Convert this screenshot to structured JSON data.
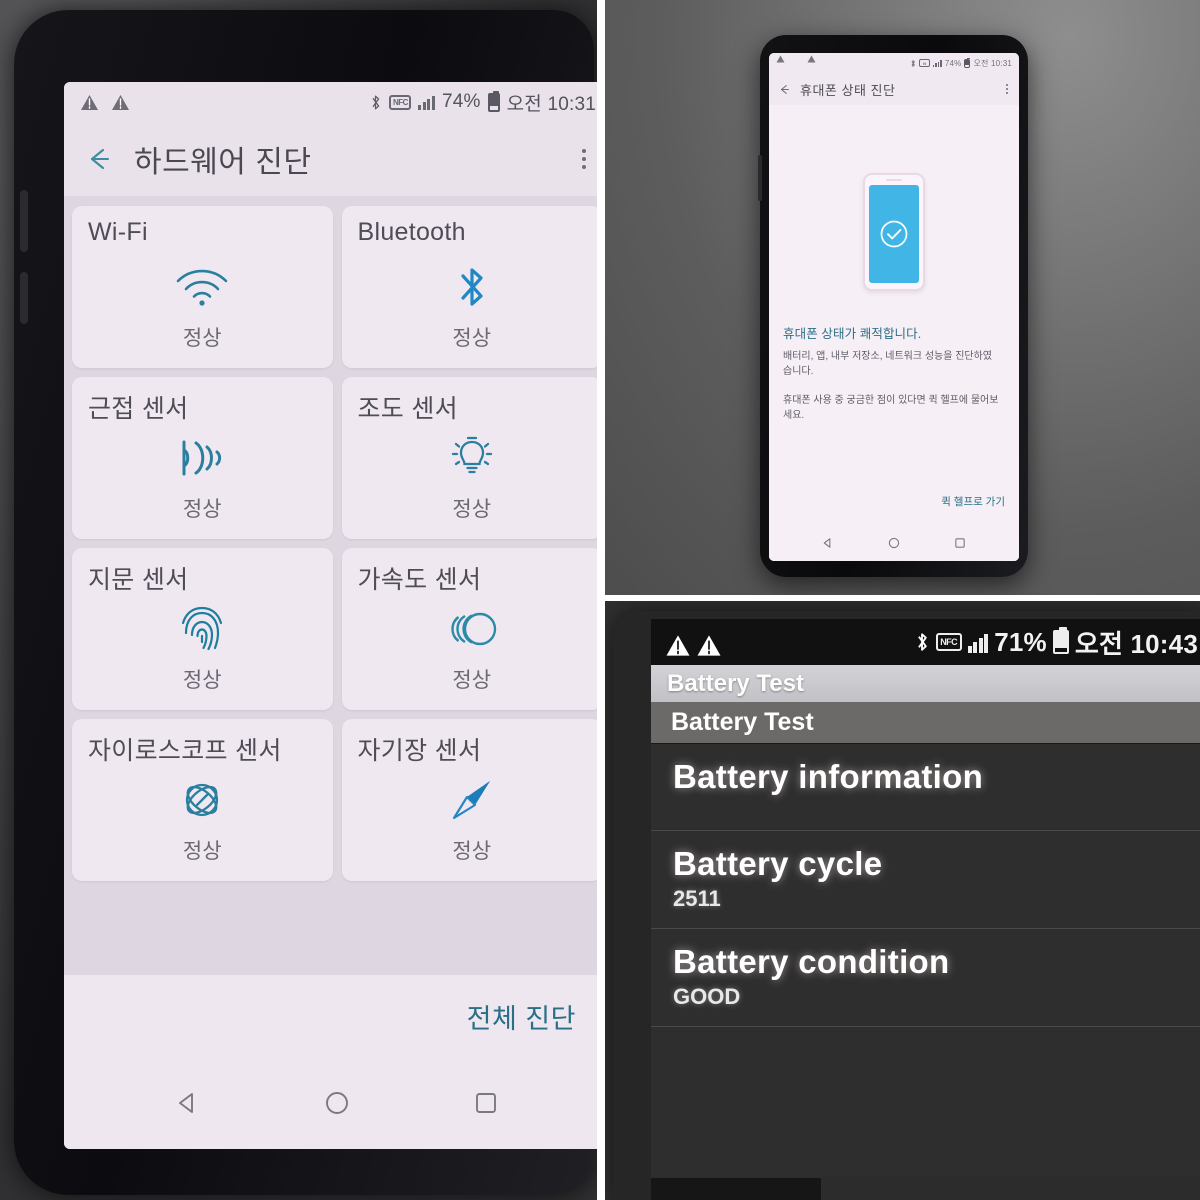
{
  "panel_left": {
    "name": "하드웨어 진단",
    "statusbar": {
      "warning_icons": [
        "warning-triangle-icon",
        "warning-triangle-icon"
      ],
      "bluetooth": "bluetooth-icon",
      "nfc": "NFC",
      "signal": "signal-bars-icon",
      "battery_percent": "74%",
      "battery": "battery-icon",
      "time": "오전 10:31"
    },
    "appbar": {
      "back": "back-arrow-icon",
      "title": "하드웨어 진단",
      "overflow": "overflow-menu-icon"
    },
    "cards": [
      {
        "title": "Wi-Fi",
        "icon": "wifi-icon",
        "status": "정상"
      },
      {
        "title": "Bluetooth",
        "icon": "bluetooth-icon",
        "status": "정상"
      },
      {
        "title": "근접 센서",
        "icon": "proximity-icon",
        "status": "정상"
      },
      {
        "title": "조도 센서",
        "icon": "light-bulb-icon",
        "status": "정상"
      },
      {
        "title": "지문 센서",
        "icon": "fingerprint-icon",
        "status": "정상"
      },
      {
        "title": "가속도 센서",
        "icon": "accelerometer-icon",
        "status": "정상"
      },
      {
        "title": "자이로스코프 센서",
        "icon": "gyroscope-icon",
        "status": "정상"
      },
      {
        "title": "자기장 센서",
        "icon": "compass-icon",
        "status": "정상"
      }
    ],
    "footer": {
      "full_diagnosis": "전체 진단"
    },
    "navbar": {
      "back": "nav-back-icon",
      "home": "nav-home-icon",
      "recents": "nav-recents-icon"
    }
  },
  "panel_top_right": {
    "statusbar": {
      "battery_percent": "74%",
      "time": "오전 10:31"
    },
    "appbar": {
      "back": "back-arrow-icon",
      "title": "휴대폰 상태 진단",
      "overflow": "overflow-menu-icon"
    },
    "illustration": {
      "icon": "phone-check-illustration",
      "check": "check-circle-icon"
    },
    "headline": "휴대폰 상태가 쾌적합니다.",
    "paragraph1": "배터리, 앱, 내부 저장소, 네트워크 성능을 진단하였습니다.",
    "paragraph2": "휴대폰 사용 중 궁금한 점이 있다면 퀵 헬프에 물어보세요.",
    "link": "퀵 헬프로 가기",
    "navbar": {
      "back": "nav-back-icon",
      "home": "nav-home-icon",
      "recents": "nav-recents-icon"
    }
  },
  "panel_bottom_right": {
    "statusbar": {
      "battery_percent": "71%",
      "nfc": "NFC",
      "time": "오전 10:43"
    },
    "title_bar": "Battery Test",
    "sub_bar": "Battery Test",
    "rows": [
      {
        "title": "Battery information",
        "value": ""
      },
      {
        "title": "Battery cycle",
        "value": "2511"
      },
      {
        "title": "Battery condition",
        "value": "GOOD"
      }
    ]
  },
  "colors": {
    "accent_teal": "#2a6f86",
    "icon_blue": "#2479a8",
    "card_bg": "#f0e8f1",
    "page_bg": "#ded6e0",
    "illus_screen": "#41b6e6"
  }
}
